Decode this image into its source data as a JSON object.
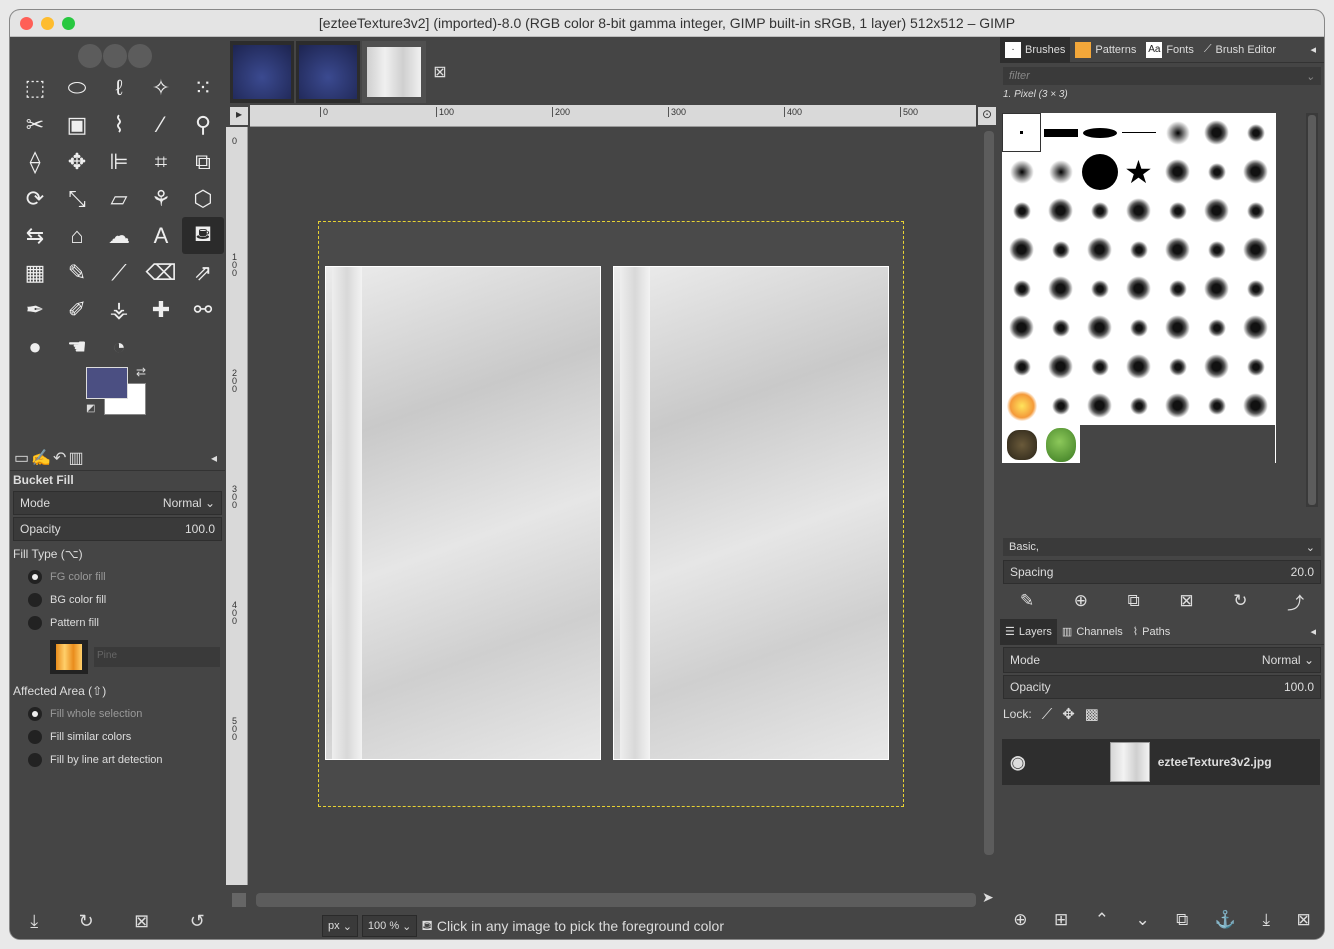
{
  "window": {
    "title": "[ezteeTexture3v2] (imported)-8.0 (RGB color 8-bit gamma integer, GIMP built-in sRGB, 1 layer) 512x512 – GIMP",
    "traffic_lights": [
      "#ff5f57",
      "#febc2e",
      "#28c840"
    ]
  },
  "toolbox": {
    "tools": [
      {
        "name": "rect-select-icon",
        "glyph": "⬚"
      },
      {
        "name": "ellipse-select-icon",
        "glyph": "⬭"
      },
      {
        "name": "free-select-icon",
        "glyph": "ℓ"
      },
      {
        "name": "fuzzy-select-icon",
        "glyph": "✧"
      },
      {
        "name": "select-by-color-icon",
        "glyph": "⁙"
      },
      {
        "name": "scissors-select-icon",
        "glyph": "✂"
      },
      {
        "name": "foreground-select-icon",
        "glyph": "▣"
      },
      {
        "name": "paths-icon",
        "glyph": "⌇"
      },
      {
        "name": "color-picker-icon",
        "glyph": "⁄"
      },
      {
        "name": "zoom-icon",
        "glyph": "⚲"
      },
      {
        "name": "measure-icon",
        "glyph": "⟠"
      },
      {
        "name": "move-icon",
        "glyph": "✥"
      },
      {
        "name": "align-icon",
        "glyph": "⊫"
      },
      {
        "name": "crop-icon",
        "glyph": "⌗"
      },
      {
        "name": "unified-transform-icon",
        "glyph": "⧉"
      },
      {
        "name": "rotate-icon",
        "glyph": "⟳"
      },
      {
        "name": "scale-icon",
        "glyph": "⤡"
      },
      {
        "name": "shear-icon",
        "glyph": "▱"
      },
      {
        "name": "warp-icon",
        "glyph": "⚘"
      },
      {
        "name": "3d-transform-icon",
        "glyph": "⬡"
      },
      {
        "name": "flip-icon",
        "glyph": "⇆"
      },
      {
        "name": "cage-icon",
        "glyph": "⌂"
      },
      {
        "name": "smudge-warp-icon",
        "glyph": "☁"
      },
      {
        "name": "text-icon",
        "glyph": "A"
      },
      {
        "name": "bucket-fill-icon",
        "glyph": "⛾"
      },
      {
        "name": "gradient-icon",
        "glyph": "▦"
      },
      {
        "name": "pencil-icon",
        "glyph": "✎"
      },
      {
        "name": "paintbrush-icon",
        "glyph": "⟋"
      },
      {
        "name": "eraser-icon",
        "glyph": "⌫"
      },
      {
        "name": "airbrush-icon",
        "glyph": "⇗"
      },
      {
        "name": "ink-icon",
        "glyph": "✒"
      },
      {
        "name": "mypaint-brush-icon",
        "glyph": "✐"
      },
      {
        "name": "clone-icon",
        "glyph": "⚶"
      },
      {
        "name": "heal-icon",
        "glyph": "✚"
      },
      {
        "name": "perspective-clone-icon",
        "glyph": "⚯"
      },
      {
        "name": "blur-icon",
        "glyph": "●"
      },
      {
        "name": "smudge-icon",
        "glyph": "☚"
      },
      {
        "name": "dodge-burn-icon",
        "glyph": "◔"
      }
    ],
    "active_tool_index": 24,
    "fg_color": "#4b4f82",
    "bg_color": "#ffffff"
  },
  "tool_options": {
    "title": "Bucket Fill",
    "mode_label": "Mode",
    "mode_value": "Normal",
    "opacity_label": "Opacity",
    "opacity_value": "100.0",
    "fill_type_label": "Fill Type  (⌥)",
    "fill_types": [
      "FG color fill",
      "BG color fill",
      "Pattern fill"
    ],
    "pattern_name": "Pine",
    "affected_area_label": "Affected Area  (⇧)",
    "affected_areas": [
      "Fill whole selection",
      "Fill similar colors",
      "Fill by line art detection"
    ]
  },
  "image_window": {
    "ruler_h_labels": [
      "0",
      "100",
      "200",
      "300",
      "400",
      "500"
    ],
    "ruler_v_labels": [
      "0",
      "1\n0\n0",
      "2\n0\n0",
      "3\n0\n0",
      "4\n0\n0",
      "5\n0\n0"
    ],
    "unit": "px",
    "zoom": "100 %",
    "status_message": "Click in any image to pick the foreground color"
  },
  "brushes_dock": {
    "tabs": [
      "Brushes",
      "Patterns",
      "Fonts",
      "Brush Editor"
    ],
    "filter_placeholder": "filter",
    "selected_brush": "1. Pixel (3 × 3)",
    "preset": "Basic,",
    "spacing_label": "Spacing",
    "spacing_value": "20.0"
  },
  "layers_dock": {
    "tabs": [
      "Layers",
      "Channels",
      "Paths"
    ],
    "mode_label": "Mode",
    "mode_value": "Normal",
    "opacity_label": "Opacity",
    "opacity_value": "100.0",
    "lock_label": "Lock:",
    "layer_name": "ezteeTexture3v2.jpg"
  }
}
